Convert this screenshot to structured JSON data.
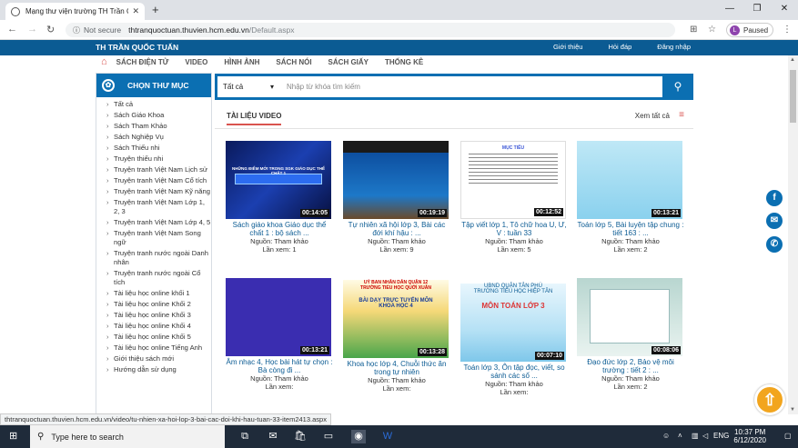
{
  "browser": {
    "tab_title": "Mạng thư viện trường TH Trần C",
    "url_host": "thtranquoctuan.thuvien.hcm.edu.vn",
    "url_path": "/Default.aspx",
    "not_secure": "Not secure",
    "paused": "Paused",
    "avatar_letter": "L"
  },
  "site": {
    "brand": "TH TRẦN QUỐC TUẤN",
    "toplinks": [
      "Giới thiệu",
      "Hỏi đáp",
      "Đăng nhập"
    ],
    "menu": [
      "SÁCH ĐIỆN TỬ",
      "VIDEO",
      "HÌNH ẢNH",
      "SÁCH NÓI",
      "SÁCH GIẤY",
      "THỐNG KÊ"
    ]
  },
  "sidebar": {
    "title": "CHỌN THƯ MỤC",
    "items": [
      "Tất cả",
      "Sách Giáo Khoa",
      "Sách Tham Khảo",
      "Sách Nghiệp Vụ",
      "Sách Thiếu nhi",
      "Truyện thiếu nhi",
      "Truyện tranh Việt Nam Lịch sử",
      "Truyện tranh Việt Nam Cổ tích",
      "Truyện tranh Việt Nam Kỹ năng",
      "Truyện tranh Việt Nam Lớp 1, 2, 3",
      "Truyện tranh Việt Nam Lớp 4, 5",
      "Truyện tranh Việt Nam Song ngữ",
      "Truyện tranh nước ngoài Danh nhân",
      "Truyện tranh nước ngoài Cổ tích",
      "Tài liệu học online khối 1",
      "Tài liệu học online Khối 2",
      "Tài liệu học online Khối 3",
      "Tài liệu học online Khối 4",
      "Tài liệu học online Khối 5",
      "Tài liệu học online Tiếng Anh",
      "Giới thiệu sách mới",
      "Hướng dẫn sử dụng"
    ]
  },
  "search": {
    "select": "Tất cả",
    "placeholder": "Nhập từ khóa tìm kiếm"
  },
  "videos": {
    "title": "TÀI LIỆU VIDEO",
    "see_all": "Xem tất cả",
    "items": [
      {
        "title": "Sách giáo khoa Giáo dục thể chất 1 : bộ sách ...",
        "source": "Nguồn: Tham khảo",
        "views": "Lần xem: 1",
        "duration": "00:14:05"
      },
      {
        "title": "Tự nhiên xã hội lớp 3, Bài các đới khí hậu : ...",
        "source": "Nguồn: Tham khảo",
        "views": "Lần xem: 9",
        "duration": "00:19:19"
      },
      {
        "title": "Tập viết lớp 1, Tô chữ hoa U, Ư, V : tuần 33",
        "source": "Nguồn: Tham khảo",
        "views": "Lần xem: 5",
        "duration": "00:12:52"
      },
      {
        "title": "Toán lớp 5, Bài luyện tập chung : tiết 163 : ...",
        "source": "Nguồn: Tham khảo",
        "views": "Lần xem: 2",
        "duration": "00:13:21"
      },
      {
        "title": "Âm nhạc 4, Học bài hát tự chọn : Bà còng đi ...",
        "source": "Nguồn: Tham khảo",
        "views": "Lần xem:",
        "duration": "00:13:21"
      },
      {
        "title": "Khoa học lớp 4, Chuỗi thức ăn trong tự nhiên",
        "source": "Nguồn: Tham khảo",
        "views": "Lần xem:",
        "duration": "00:13:28"
      },
      {
        "title": "Toán lớp 3, Ôn tập đọc, viết, so sánh các số ...",
        "source": "Nguồn: Tham khảo",
        "views": "Lần xem:",
        "duration": "00:07:10"
      },
      {
        "title": "Đạo đức lớp 2, Bảo vệ môi trường : tiết 2 : ...",
        "source": "Nguồn: Tham khảo",
        "views": "Lần xem: 2",
        "duration": "00:08:06"
      }
    ]
  },
  "thumb_text": {
    "t1": "NHỮNG ĐIỂM MỚI TRONG SGK GIÁO DỤC THỂ CHẤT 1",
    "t3": "MỤC TIÊU",
    "t6a": "UỶ BAN NHÂN DÂN QUẬN 12",
    "t6b": "TRƯỜNG TIỂU HỌC QUỚI XUÂN",
    "t6c": "BÀI DẠY TRỰC TUYẾN MÔN KHOA HỌC 4",
    "t7a": "UBND QUẬN TÂN PHÚ",
    "t7b": "TRƯỜNG TIỂU HỌC HIỆP TÂN",
    "t7c": "MÔN TOÁN LỚP 3"
  },
  "status_url": "thtranquoctuan.thuvien.hcm.edu.vn/video/tu-nhien-xa-hoi-lop-3-bai-cac-doi-khi-hau-tuan-33-item2413.aspx",
  "taskbar": {
    "search": "Type here to search",
    "lang": "ENG",
    "time": "10:37 PM",
    "date": "6/12/2020"
  }
}
